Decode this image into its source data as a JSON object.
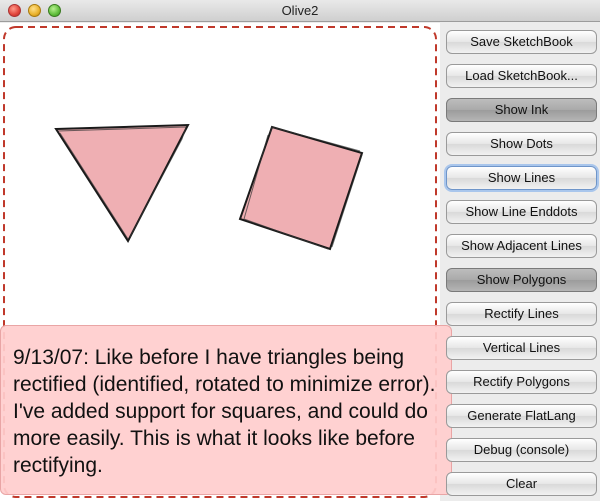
{
  "window": {
    "title": "Olive2"
  },
  "buttons": [
    {
      "label": "Save SketchBook",
      "state": "normal"
    },
    {
      "label": "Load SketchBook...",
      "state": "normal"
    },
    {
      "label": "Show Ink",
      "state": "pressed"
    },
    {
      "label": "Show Dots",
      "state": "normal"
    },
    {
      "label": "Show Lines",
      "state": "focused"
    },
    {
      "label": "Show Line Enddots",
      "state": "normal"
    },
    {
      "label": "Show Adjacent Lines",
      "state": "normal"
    },
    {
      "label": "Show Polygons",
      "state": "pressed"
    },
    {
      "label": "Rectify Lines",
      "state": "normal"
    },
    {
      "label": "Vertical Lines",
      "state": "normal"
    },
    {
      "label": "Rectify Polygons",
      "state": "normal"
    },
    {
      "label": "Generate FlatLang",
      "state": "normal"
    },
    {
      "label": "Debug (console)",
      "state": "normal"
    },
    {
      "label": "Clear",
      "state": "normal"
    }
  ],
  "note": {
    "text": "9/13/07: Like before I have triangles being rectified (identified, rotated to minimize error). I've added support for squares, and could do more easily. This is what it looks like before rectifying."
  },
  "colors": {
    "shape_fill": "#efafb3",
    "shape_stroke": "#1a1a1a",
    "selection_dash": "#c0392b",
    "note_bg": "#ffcdcd"
  }
}
